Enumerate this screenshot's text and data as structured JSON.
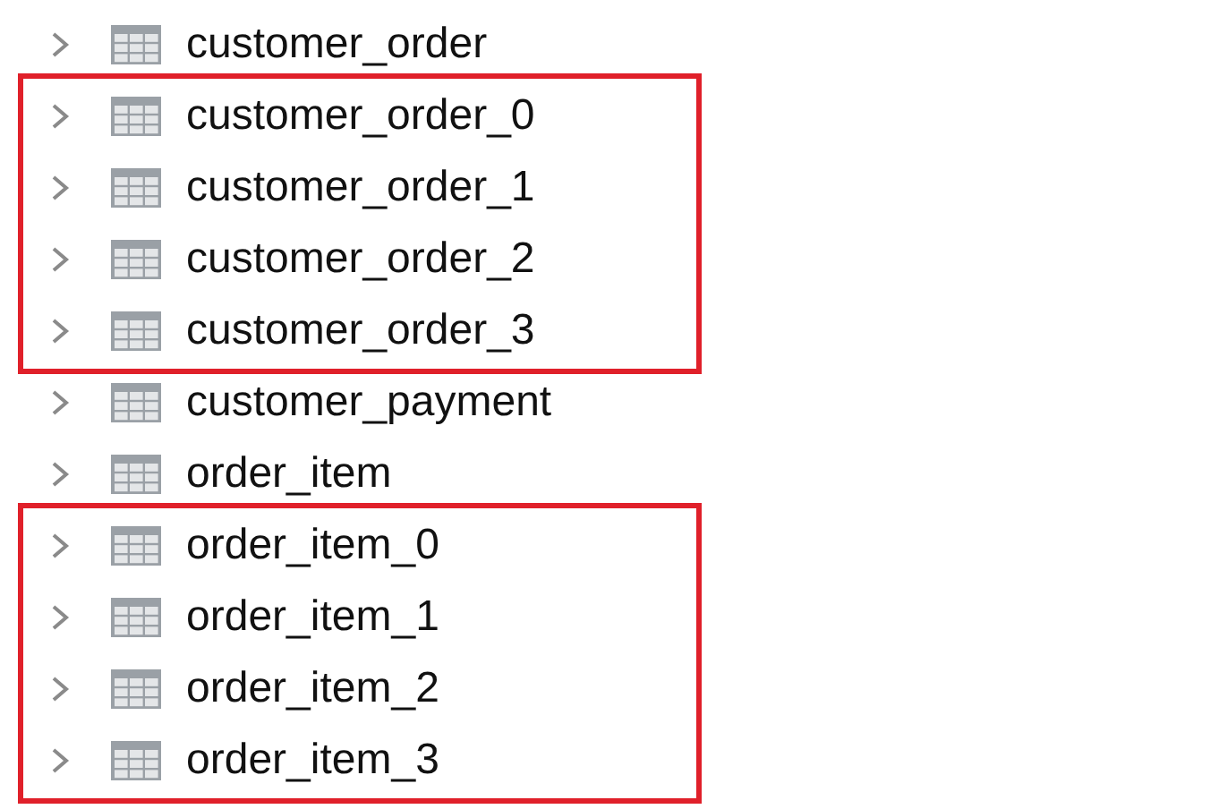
{
  "groups": [
    {
      "highlighted": false,
      "tables": [
        {
          "name": "customer_order",
          "expanded": false
        }
      ]
    },
    {
      "highlighted": true,
      "tables": [
        {
          "name": "customer_order_0",
          "expanded": false
        },
        {
          "name": "customer_order_1",
          "expanded": false
        },
        {
          "name": "customer_order_2",
          "expanded": false
        },
        {
          "name": "customer_order_3",
          "expanded": false
        }
      ]
    },
    {
      "highlighted": false,
      "tables": [
        {
          "name": "customer_payment",
          "expanded": false
        },
        {
          "name": "order_item",
          "expanded": false
        }
      ]
    },
    {
      "highlighted": true,
      "tables": [
        {
          "name": "order_item_0",
          "expanded": false
        },
        {
          "name": "order_item_1",
          "expanded": false
        },
        {
          "name": "order_item_2",
          "expanded": false
        },
        {
          "name": "order_item_3",
          "expanded": false
        }
      ]
    }
  ]
}
